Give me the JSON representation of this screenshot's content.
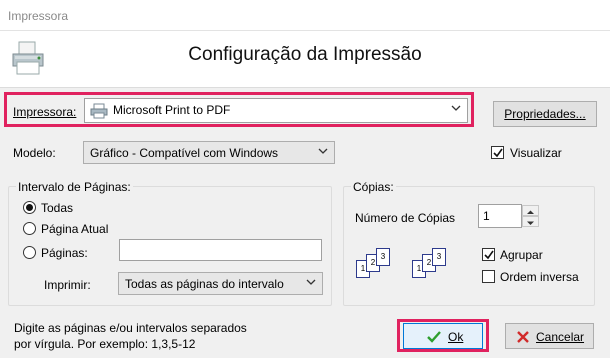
{
  "window": {
    "title": "Impressora"
  },
  "header": {
    "title": "Configuração da Impressão"
  },
  "printer": {
    "label": "Impressora:",
    "selected": "Microsoft Print to PDF",
    "properties_button": "Propriedades..."
  },
  "model": {
    "label": "Modelo:",
    "selected": "Gráfico - Compatível com Windows",
    "preview_label": "Visualizar",
    "preview_checked": true
  },
  "page_range": {
    "legend": "Intervalo de Páginas:",
    "options": [
      "Todas",
      "Página Atual",
      "Páginas:"
    ],
    "selected_index": 0,
    "pages_value": "",
    "print_label": "Imprimir:",
    "print_selected": "Todas as páginas do intervalo"
  },
  "copies": {
    "legend": "Cópias:",
    "count_label": "Número de Cópias",
    "count_value": "1",
    "collate_label": "Agrupar",
    "collate_checked": true,
    "reverse_label": "Ordem inversa",
    "reverse_checked": false,
    "doc_numbers": [
      "1",
      "2",
      "3"
    ]
  },
  "hint": {
    "line1": "Digite as páginas e/ou intervalos separados",
    "line2": "por vírgula.  Por exemplo: 1,3,5-12"
  },
  "buttons": {
    "ok": "Ok",
    "cancel": "Cancelar"
  },
  "colors": {
    "highlight": "#e0225f",
    "doc_border": "#2d3a8c",
    "ok_check": "#2e9e2e",
    "cancel_x": "#d12a2a"
  }
}
